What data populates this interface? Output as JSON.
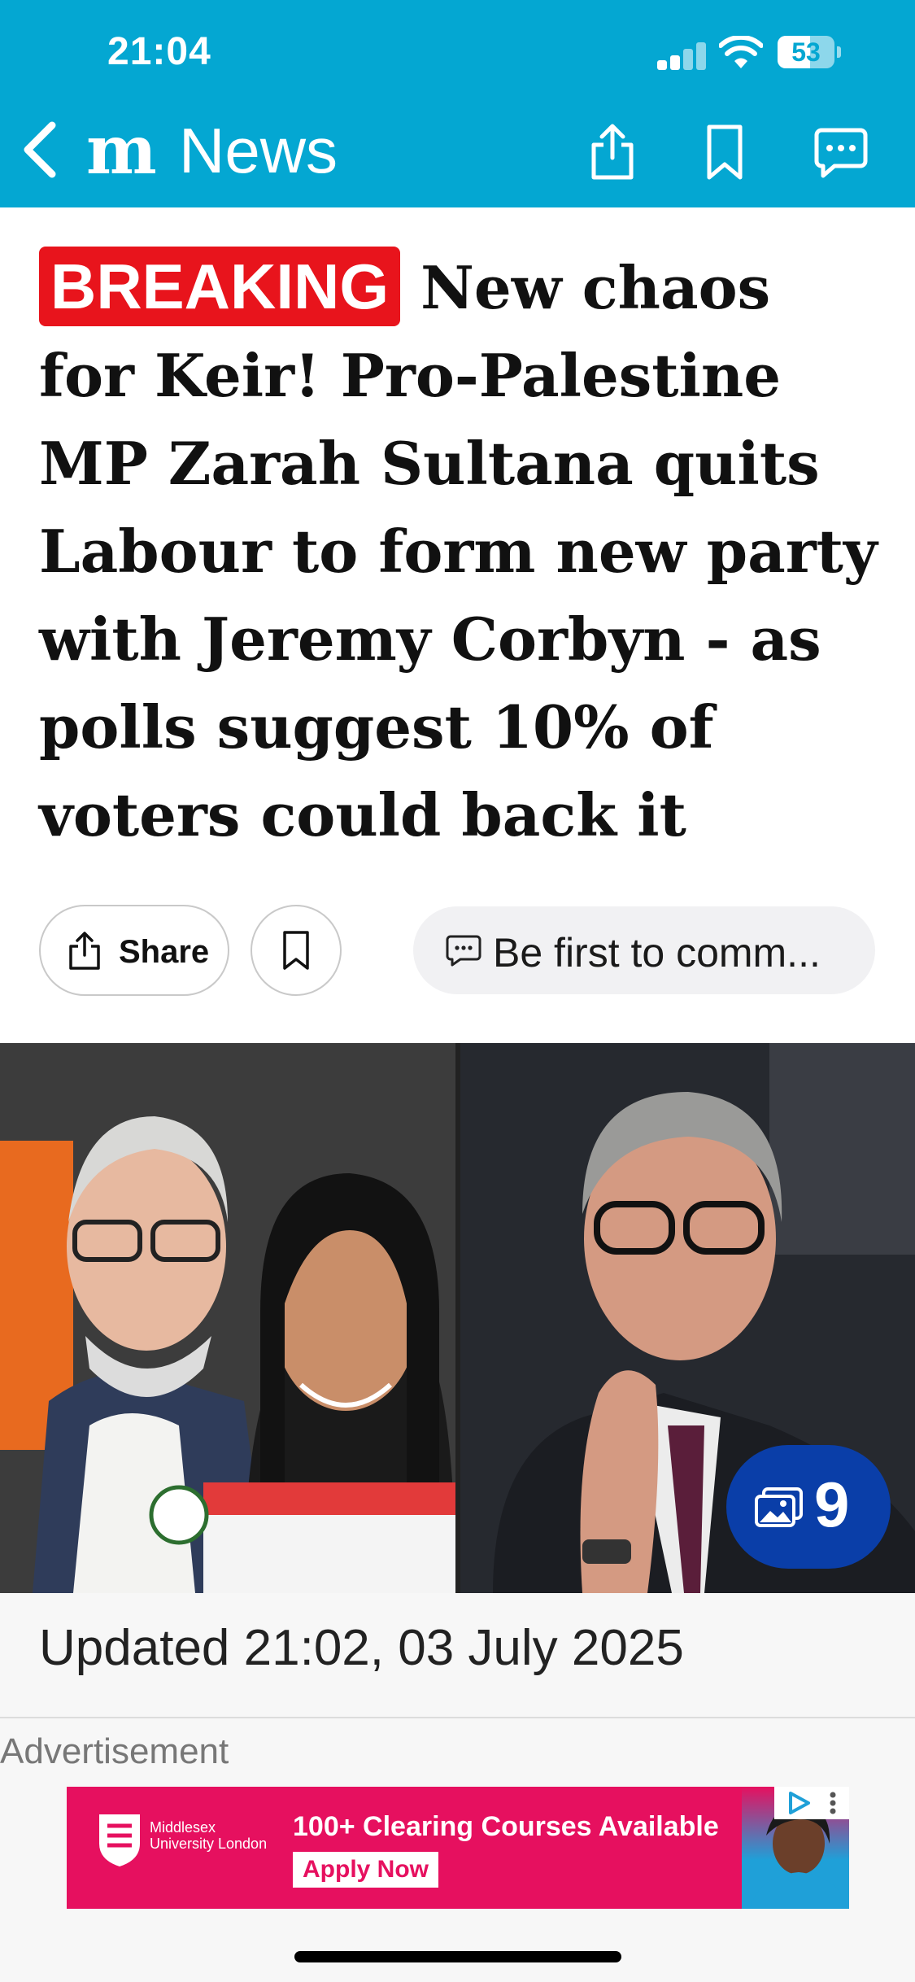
{
  "status_bar": {
    "time": "21:04",
    "battery": "53"
  },
  "nav": {
    "title": "News",
    "logo": "m"
  },
  "article": {
    "badge": "BREAKING",
    "headline": "New chaos for Keir! Pro-Palestine MP Zarah Sultana quits Labour to form new party with Jeremy Corbyn - as polls suggest 10% of voters could back it",
    "actions": {
      "share_label": "Share",
      "comment_label": "Be first to comm..."
    },
    "gallery_count": "9",
    "updated": "Updated 21:02, 03 July 2025"
  },
  "ad": {
    "label": "Advertisement",
    "advertiser": "Middlesex University London",
    "headline": "100+ Clearing Courses Available",
    "cta": "Apply Now"
  },
  "colors": {
    "header": "#04a7d2",
    "breaking": "#e8141c",
    "gallery_pill": "#0a3ea8",
    "ad_bg": "#e6105f"
  }
}
